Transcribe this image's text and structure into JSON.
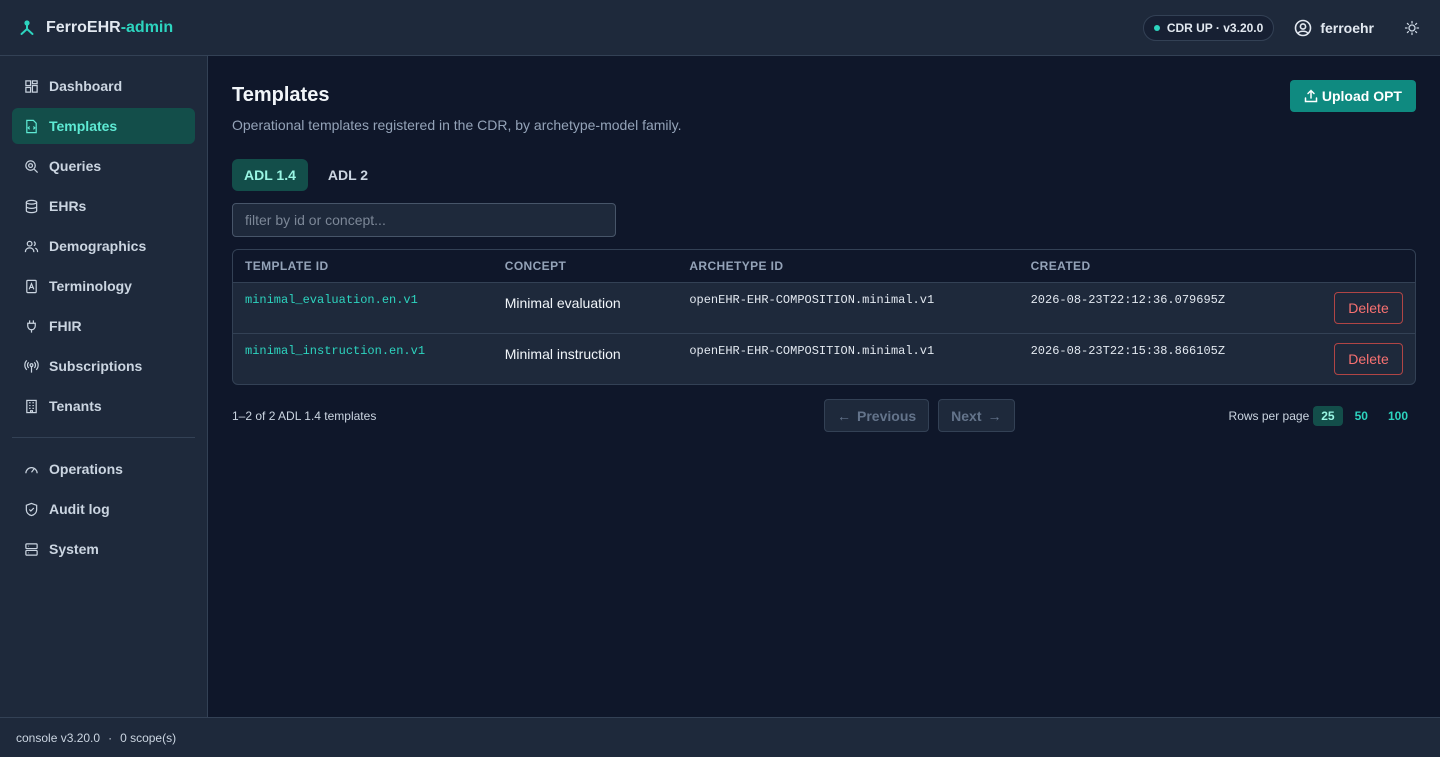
{
  "brand": {
    "name": "FerroEHR",
    "suffix": "-admin"
  },
  "header": {
    "status": "CDR UP · v3.20.0",
    "user": "ferroehr"
  },
  "sidebar": {
    "items": [
      {
        "label": "Dashboard",
        "icon": "dashboard-icon",
        "active": false
      },
      {
        "label": "Templates",
        "icon": "template-file-icon",
        "active": true
      },
      {
        "label": "Queries",
        "icon": "search-icon",
        "active": false
      },
      {
        "label": "EHRs",
        "icon": "database-icon",
        "active": false
      },
      {
        "label": "Demographics",
        "icon": "users-icon",
        "active": false
      },
      {
        "label": "Terminology",
        "icon": "book-icon",
        "active": false
      },
      {
        "label": "FHIR",
        "icon": "plug-icon",
        "active": false
      },
      {
        "label": "Subscriptions",
        "icon": "radio-icon",
        "active": false
      },
      {
        "label": "Tenants",
        "icon": "building-icon",
        "active": false
      }
    ],
    "secondary": [
      {
        "label": "Operations",
        "icon": "gauge-icon"
      },
      {
        "label": "Audit log",
        "icon": "shield-icon"
      },
      {
        "label": "System",
        "icon": "server-icon"
      }
    ]
  },
  "page": {
    "title": "Templates",
    "subtitle": "Operational templates registered in the CDR, by archetype-model family.",
    "upload_label": "Upload OPT",
    "tabs": [
      "ADL 1.4",
      "ADL 2"
    ],
    "filter_placeholder": "filter by id or concept..."
  },
  "table": {
    "headers": [
      "TEMPLATE ID",
      "CONCEPT",
      "ARCHETYPE ID",
      "CREATED"
    ],
    "rows": [
      {
        "template_id": "minimal_evaluation.en.v1",
        "concept": "Minimal evaluation",
        "archetype_id": "openEHR-EHR-COMPOSITION.minimal.v1",
        "created": "2026-08-23T22:12:36.079695Z",
        "action": "Delete"
      },
      {
        "template_id": "minimal_instruction.en.v1",
        "concept": "Minimal instruction",
        "archetype_id": "openEHR-EHR-COMPOSITION.minimal.v1",
        "created": "2026-08-23T22:15:38.866105Z",
        "action": "Delete"
      }
    ]
  },
  "pagination": {
    "summary": "1–2 of 2 ADL 1.4 templates",
    "previous": "Previous",
    "next": "Next",
    "rows_label": "Rows per page",
    "options": [
      "25",
      "50",
      "100"
    ],
    "selected": "25"
  },
  "footer": {
    "version": "console v3.20.0",
    "sep": "·",
    "scopes": "0 scope(s)"
  },
  "colors": {
    "accent": "#2dd4bf",
    "danger": "#f87171",
    "background": "#0f172a",
    "panel": "#1e293b"
  }
}
